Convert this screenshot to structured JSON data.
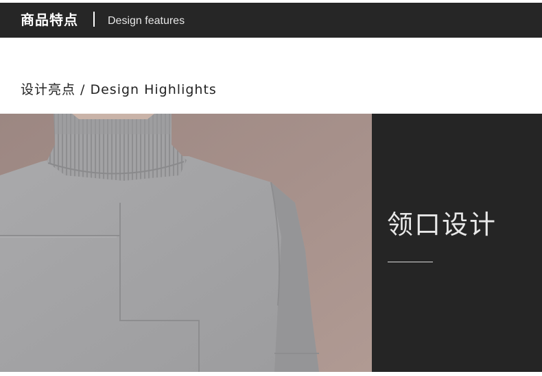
{
  "banner": {
    "title": "商品特点",
    "subtitle": "Design features"
  },
  "section": {
    "heading": "设计亮点 / Design Highlights"
  },
  "panel": {
    "title": "领口设计"
  },
  "photo": {
    "subject": "grey-turtleneck-sweater-photo"
  },
  "colors": {
    "banner_bg": "#262626",
    "panel_bg": "#252525",
    "sweater": "#a6a6a8",
    "backdrop": "#a48f8a",
    "text_dark": "#222222"
  }
}
